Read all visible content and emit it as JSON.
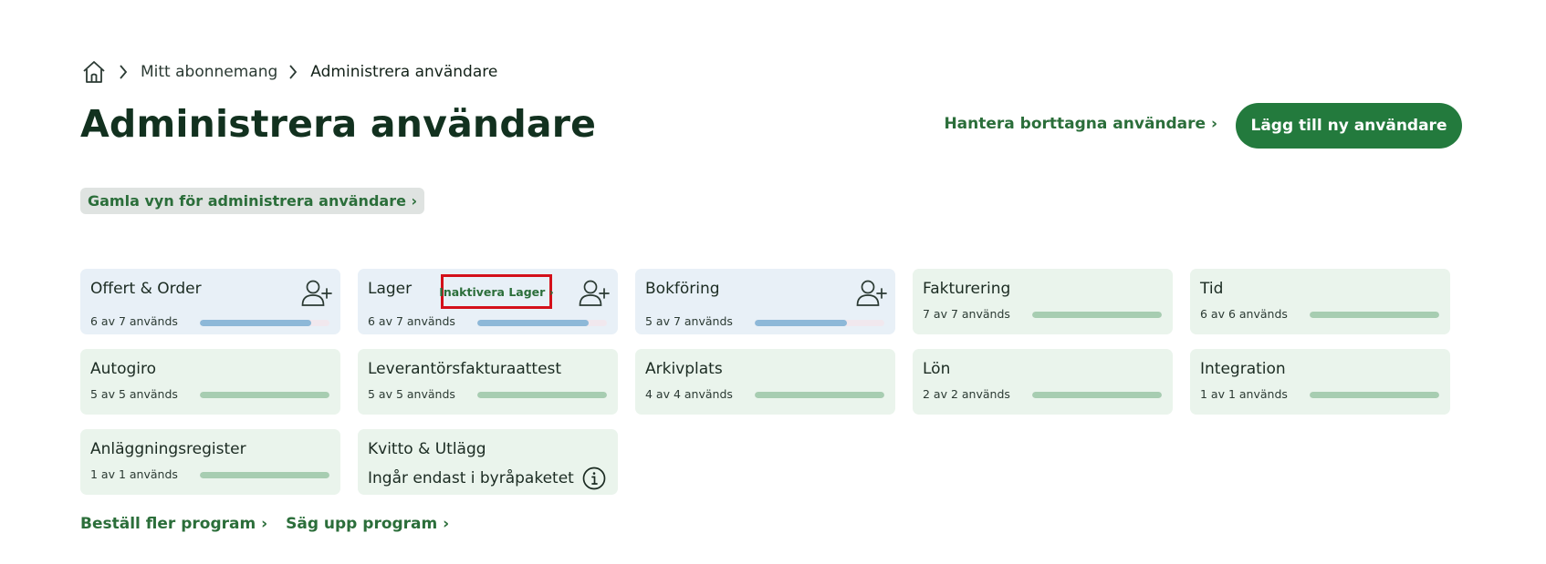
{
  "breadcrumb": {
    "items": [
      {
        "label": "Mitt abonnemang"
      },
      {
        "label": "Administrera användare"
      }
    ]
  },
  "page_title": "Administrera användare",
  "header_actions": {
    "manage_deleted": "Hantera borttagna användare ›",
    "add_user": "Lägg till ny användare"
  },
  "old_view_link": "Gamla vyn för administrera användare ›",
  "colors": {
    "primary_green": "#237a3d",
    "link_green": "#2b6e3a",
    "card_green_bg": "#eaf4ec",
    "card_blue_bg": "#e8f0f7",
    "bar_blue": "#8db8d8",
    "bar_green": "#a7cdb1",
    "highlight_red": "#d4101a"
  },
  "programs": [
    {
      "name": "Offert & Order",
      "usage": "6 av 7 används",
      "used": 6,
      "total": 7,
      "style": "blue",
      "add_icon": "add-user-icon"
    },
    {
      "name": "Lager",
      "usage": "6 av 7 används",
      "used": 6,
      "total": 7,
      "style": "blue",
      "add_icon": "add-user-icon",
      "inactivate": "Inaktivera Lager ›"
    },
    {
      "name": "Bokföring",
      "usage": "5 av 7 används",
      "used": 5,
      "total": 7,
      "style": "blue",
      "add_icon": "add-user-icon"
    },
    {
      "name": "Fakturering",
      "usage": "7 av 7 används",
      "used": 7,
      "total": 7,
      "style": "green"
    },
    {
      "name": "Tid",
      "usage": "6 av 6 används",
      "used": 6,
      "total": 6,
      "style": "green"
    },
    {
      "name": "Autogiro",
      "usage": "5 av 5 används",
      "used": 5,
      "total": 5,
      "style": "green"
    },
    {
      "name": "Leverantörsfakturaattest",
      "usage": "5 av 5 används",
      "used": 5,
      "total": 5,
      "style": "green"
    },
    {
      "name": "Arkivplats",
      "usage": "4 av 4 används",
      "used": 4,
      "total": 4,
      "style": "green"
    },
    {
      "name": "Lön",
      "usage": "2 av 2 används",
      "used": 2,
      "total": 2,
      "style": "green"
    },
    {
      "name": "Integration",
      "usage": "1 av 1 används",
      "used": 1,
      "total": 1,
      "style": "green"
    },
    {
      "name": "Anläggningsregister",
      "usage": "1 av 1 används",
      "used": 1,
      "total": 1,
      "style": "green"
    },
    {
      "name": "Kvitto & Utlägg",
      "note": "Ingår endast i byråpaketet",
      "style": "green",
      "info_icon": "info-icon"
    }
  ],
  "footer_links": {
    "order_more": "Beställ fler program ›",
    "cancel": "Säg upp program ›"
  }
}
